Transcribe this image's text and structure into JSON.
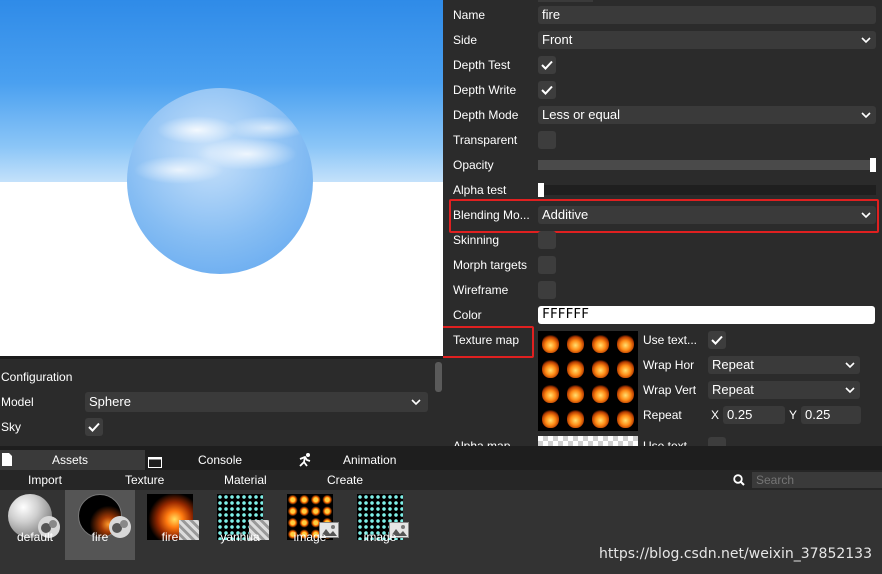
{
  "viewport": {},
  "config": {
    "title": "Configuration",
    "model_label": "Model",
    "model_value": "Sphere",
    "sky_label": "Sky",
    "sky_checked": true
  },
  "inspector": {
    "name_label": "Name",
    "name_value": "fire",
    "side_label": "Side",
    "side_value": "Front",
    "depth_test_label": "Depth Test",
    "depth_write_label": "Depth Write",
    "depth_mode_label": "Depth Mode",
    "depth_mode_value": "Less or equal",
    "transparent_label": "Transparent",
    "opacity_label": "Opacity",
    "opacity_value": 1.0,
    "alpha_test_label": "Alpha test",
    "alpha_test_value": 0.0,
    "blending_label": "Blending Mo...",
    "blending_value": "Additive",
    "skinning_label": "Skinning",
    "morph_label": "Morph targets",
    "wireframe_label": "Wireframe",
    "color_label": "Color",
    "color_value": "FFFFFF",
    "texture_label": "Texture map",
    "use_texture_label": "Use text...",
    "wrap_hor_label": "Wrap Hor",
    "wrap_hor_value": "Repeat",
    "wrap_vert_label": "Wrap Vert",
    "wrap_vert_value": "Repeat",
    "repeat_label": "Repeat",
    "repeat_x_label": "X",
    "repeat_x_value": "0.25",
    "repeat_y_label": "Y",
    "repeat_y_value": "0.25",
    "alpha_map_label": "Alpha map",
    "use_alpha_label": "Use text..."
  },
  "tabs": {
    "assets": "Assets",
    "console": "Console",
    "animation": "Animation"
  },
  "assets_bar": {
    "import": "Import",
    "texture": "Texture",
    "material": "Material",
    "create": "Create",
    "search_placeholder": "Search"
  },
  "assets": [
    {
      "label": "default"
    },
    {
      "label": "fire"
    },
    {
      "label": "fire"
    },
    {
      "label": "yanhua"
    },
    {
      "label": "image"
    },
    {
      "label": "image"
    }
  ],
  "watermark": "https://blog.csdn.net/weixin_37852133",
  "colors": {
    "highlight": "#e02020",
    "panel": "#2b2b2b",
    "field": "#3a3a3a"
  }
}
